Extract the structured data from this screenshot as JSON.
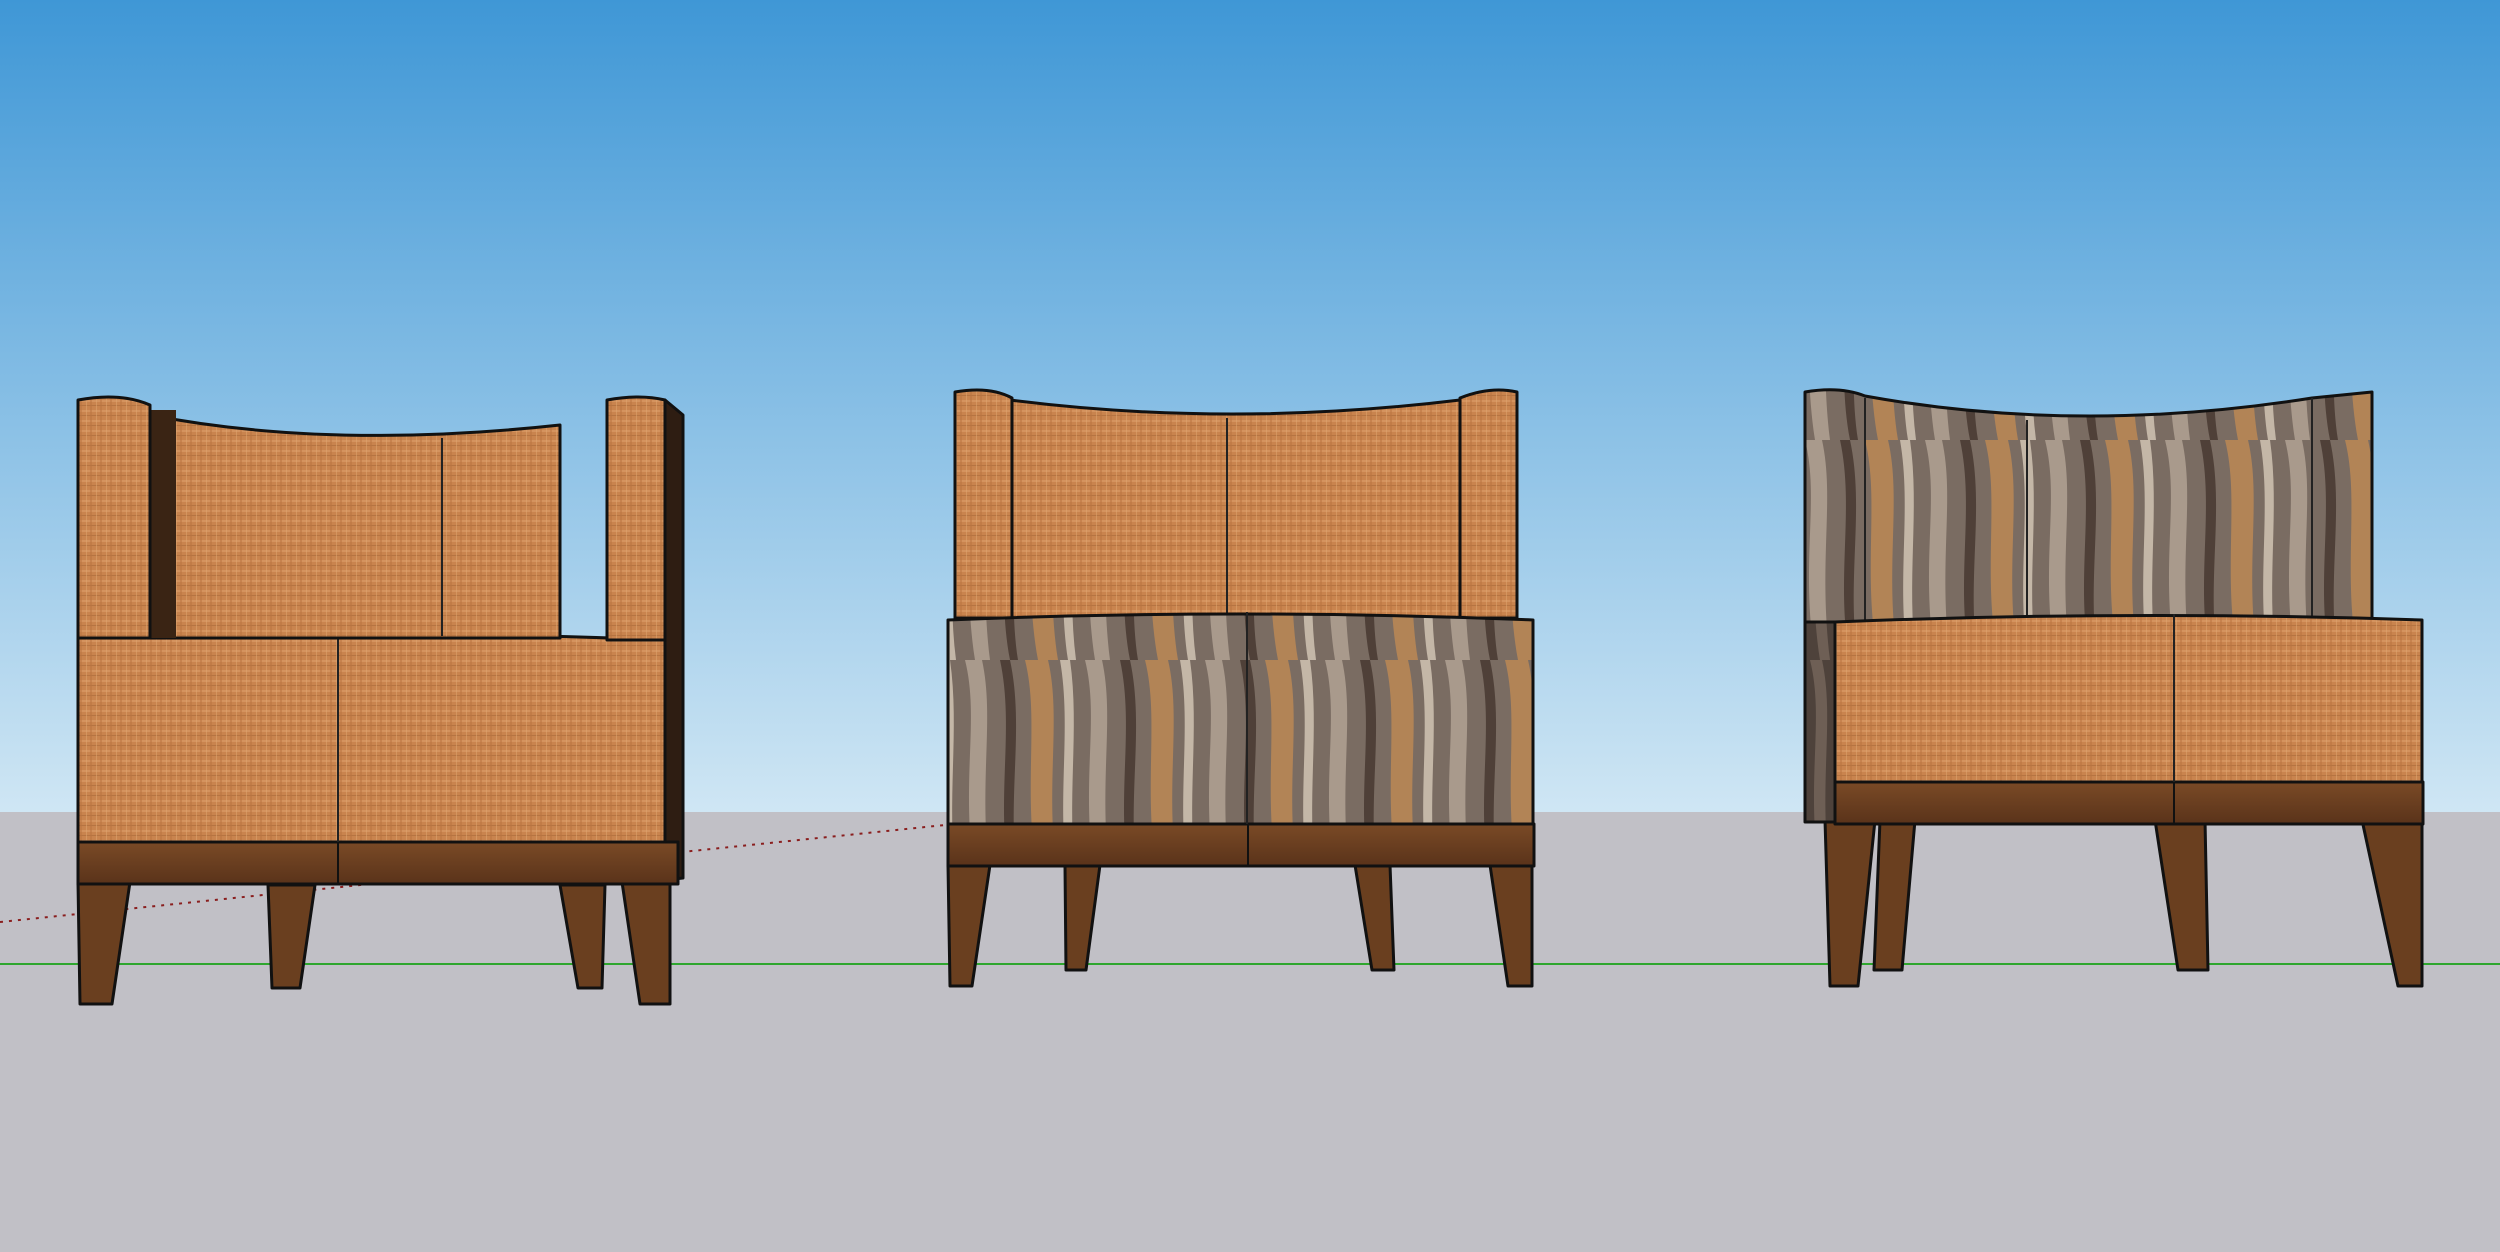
{
  "scene": {
    "sky_top_color": "#3f97d6",
    "sky_bottom_color": "#cfe6f4",
    "ground_color": "#c1c0c6",
    "green_axis_color": "#2ea62e",
    "red_axis_color": "#8a1e1e",
    "outline_color": "#111111"
  },
  "materials": {
    "fabric_orange": "#c9844e",
    "fabric_orange_light": "#d99a66",
    "fabric_orange_dark": "#a8693b",
    "wood_texture_dark": "#6d6058",
    "wood_texture_light": "#a99a8c",
    "wood_base": "#6b3e1e",
    "wood_base_dark": "#3f2412",
    "wood_legs": "#6a3f1f"
  },
  "chairs": [
    {
      "name": "chair-left-all-fabric",
      "back_material": "fabric",
      "seat_material": "fabric"
    },
    {
      "name": "chair-middle-wood-front",
      "back_material": "fabric",
      "seat_material": "wood"
    },
    {
      "name": "chair-right-wood-back",
      "back_material": "wood",
      "seat_material": "fabric"
    }
  ]
}
